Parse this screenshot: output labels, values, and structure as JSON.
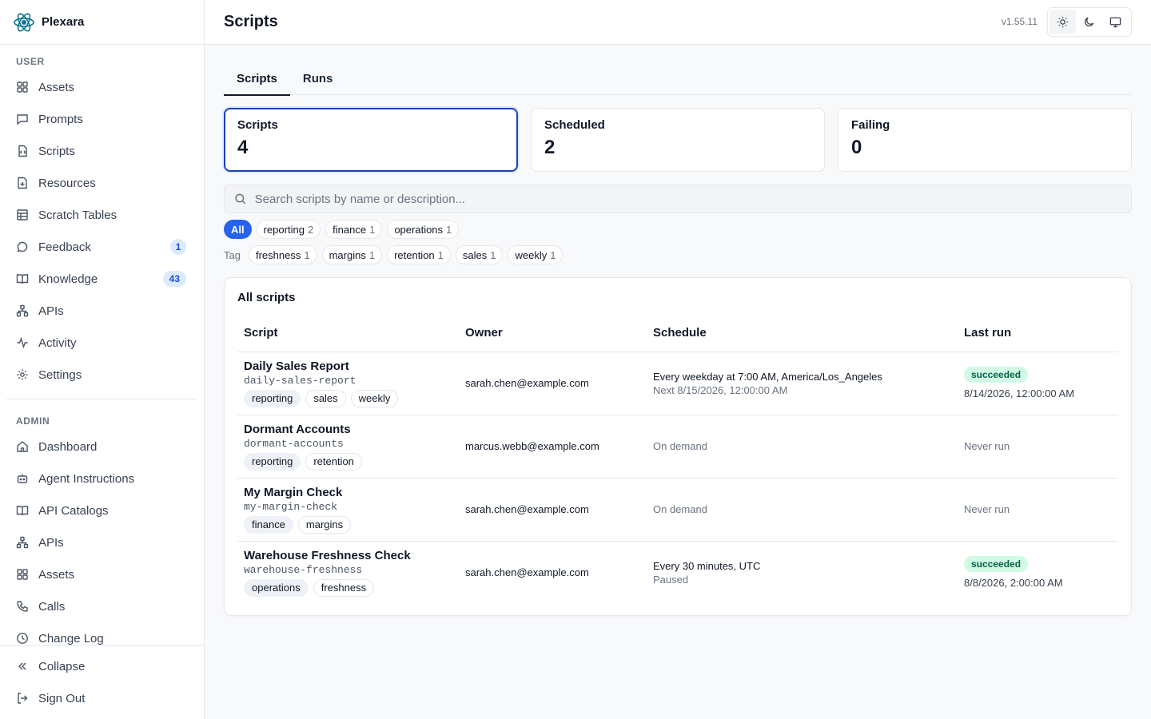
{
  "app": {
    "name": "Plexara",
    "version": "v1.55.11"
  },
  "sidebar": {
    "user_label": "USER",
    "user_items": [
      {
        "label": "Assets",
        "icon": "grid-icon"
      },
      {
        "label": "Prompts",
        "icon": "message-square-icon"
      },
      {
        "label": "Scripts",
        "icon": "file-code-icon"
      },
      {
        "label": "Resources",
        "icon": "file-plus-icon"
      },
      {
        "label": "Scratch Tables",
        "icon": "table-icon"
      },
      {
        "label": "Feedback",
        "icon": "message-circle-icon",
        "badge": "1"
      },
      {
        "label": "Knowledge",
        "icon": "book-open-icon",
        "badge": "43"
      },
      {
        "label": "APIs",
        "icon": "network-icon"
      },
      {
        "label": "Activity",
        "icon": "activity-icon"
      },
      {
        "label": "Settings",
        "icon": "gear-icon"
      }
    ],
    "admin_label": "ADMIN",
    "admin_items": [
      {
        "label": "Dashboard",
        "icon": "home-icon"
      },
      {
        "label": "Agent Instructions",
        "icon": "bot-icon"
      },
      {
        "label": "API Catalogs",
        "icon": "book-open-icon"
      },
      {
        "label": "APIs",
        "icon": "network-icon"
      },
      {
        "label": "Assets",
        "icon": "grid-icon"
      },
      {
        "label": "Calls",
        "icon": "phone-icon"
      },
      {
        "label": "Change Log",
        "icon": "clock-icon"
      }
    ],
    "collapse_label": "Collapse",
    "signout_label": "Sign Out"
  },
  "header": {
    "title": "Scripts"
  },
  "tabs": [
    {
      "label": "Scripts",
      "active": true
    },
    {
      "label": "Runs",
      "active": false
    }
  ],
  "stats": [
    {
      "label": "Scripts",
      "value": "4",
      "selected": true
    },
    {
      "label": "Scheduled",
      "value": "2",
      "selected": false
    },
    {
      "label": "Failing",
      "value": "0",
      "selected": false
    }
  ],
  "search": {
    "placeholder": "Search scripts by name or description..."
  },
  "filters": {
    "all_label": "All",
    "categories": [
      {
        "label": "reporting",
        "count": "2"
      },
      {
        "label": "finance",
        "count": "1"
      },
      {
        "label": "operations",
        "count": "1"
      }
    ],
    "tag_label": "Tag",
    "tags": [
      {
        "label": "freshness",
        "count": "1"
      },
      {
        "label": "margins",
        "count": "1"
      },
      {
        "label": "retention",
        "count": "1"
      },
      {
        "label": "sales",
        "count": "1"
      },
      {
        "label": "weekly",
        "count": "1"
      }
    ]
  },
  "table": {
    "title": "All scripts",
    "columns": [
      "Script",
      "Owner",
      "Schedule",
      "Last run"
    ],
    "rows": [
      {
        "name": "Daily Sales Report",
        "slug": "daily-sales-report",
        "tags": [
          "reporting",
          "sales",
          "weekly"
        ],
        "owner": "sarah.chen@example.com",
        "schedule": "Every weekday at 7:00 AM, America/Los_Angeles",
        "schedule_sub": "Next 8/15/2026, 12:00:00 AM",
        "status": "succeeded",
        "last_run": "8/14/2026, 12:00:00 AM"
      },
      {
        "name": "Dormant Accounts",
        "slug": "dormant-accounts",
        "tags": [
          "reporting",
          "retention"
        ],
        "owner": "marcus.webb@example.com",
        "schedule": "On demand",
        "schedule_sub": "",
        "status": "",
        "last_run": "Never run"
      },
      {
        "name": "My Margin Check",
        "slug": "my-margin-check",
        "tags": [
          "finance",
          "margins"
        ],
        "owner": "sarah.chen@example.com",
        "schedule": "On demand",
        "schedule_sub": "",
        "status": "",
        "last_run": "Never run"
      },
      {
        "name": "Warehouse Freshness Check",
        "slug": "warehouse-freshness",
        "tags": [
          "operations",
          "freshness"
        ],
        "owner": "sarah.chen@example.com",
        "schedule": "Every 30 minutes, UTC",
        "schedule_sub": "Paused",
        "status": "succeeded",
        "last_run": "8/8/2026, 2:00:00 AM"
      }
    ]
  },
  "colors": {
    "accent": "#2563eb",
    "selected_border": "#1e40af",
    "success_bg": "#d1fae5",
    "success_fg": "#065f46",
    "brand": "#0e7490"
  }
}
